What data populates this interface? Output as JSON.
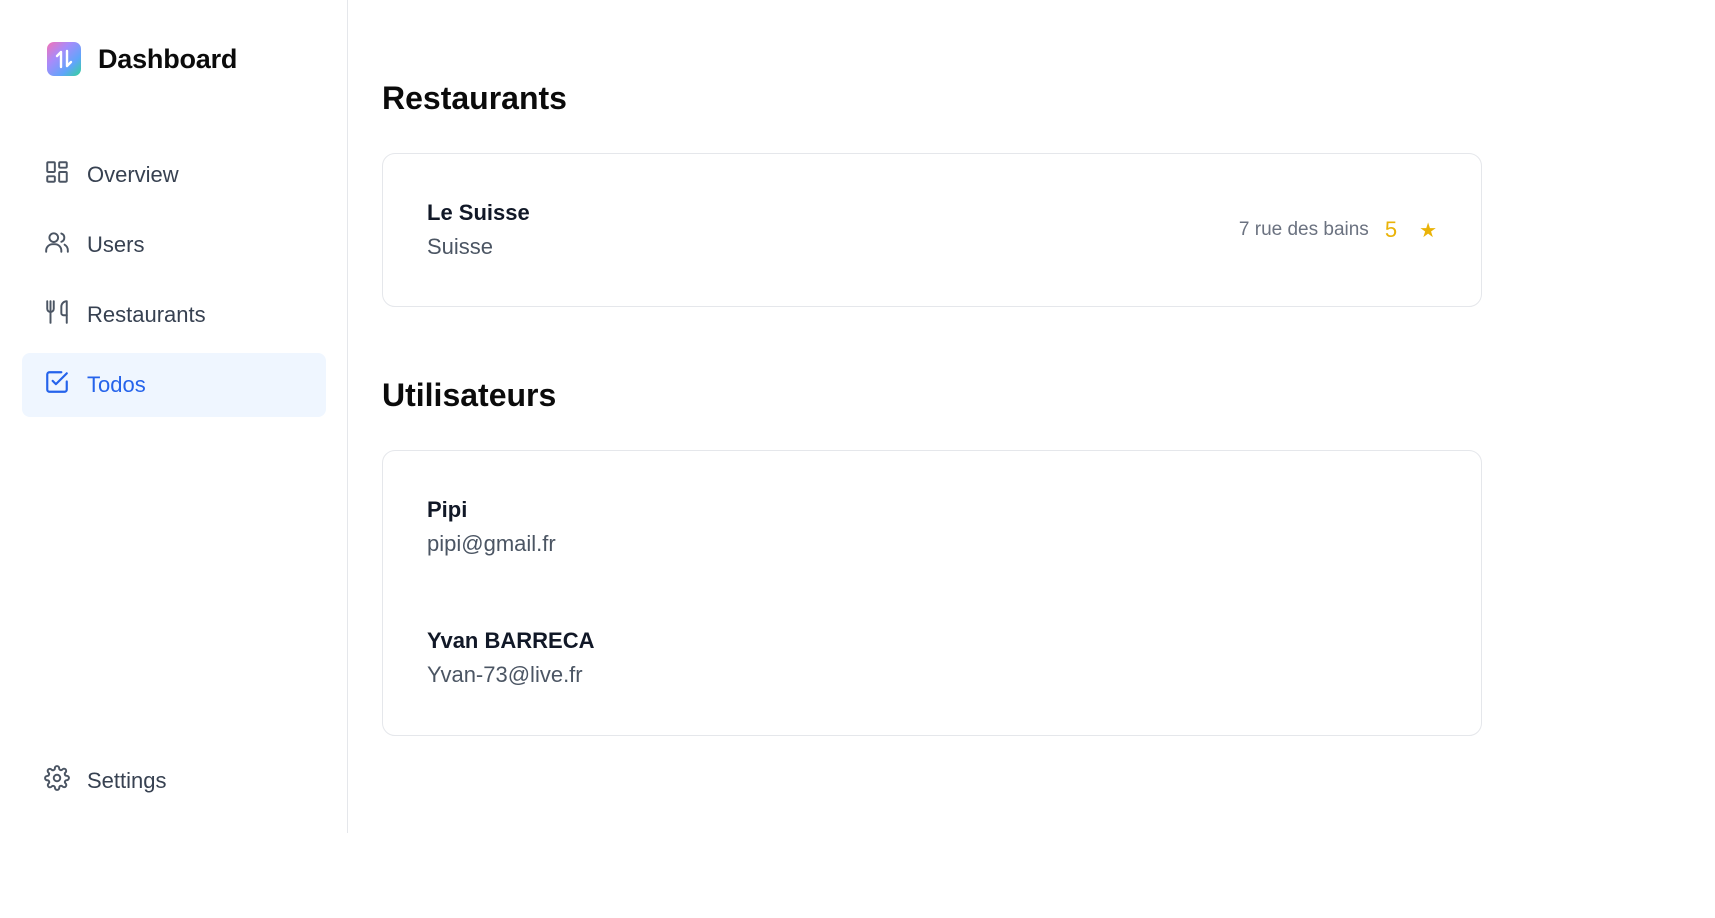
{
  "app": {
    "title": "Dashboard"
  },
  "sidebar": {
    "items": [
      {
        "label": "Overview",
        "icon": "overview-grid-icon",
        "active": false
      },
      {
        "label": "Users",
        "icon": "users-icon",
        "active": false
      },
      {
        "label": "Restaurants",
        "icon": "fork-knife-icon",
        "active": false
      },
      {
        "label": "Todos",
        "icon": "checkbox-icon",
        "active": true
      }
    ],
    "settings": {
      "label": "Settings",
      "icon": "gear-icon"
    }
  },
  "restaurants": {
    "title": "Restaurants",
    "items": [
      {
        "name": "Le Suisse",
        "cuisine": "Suisse",
        "address": "7 rue des bains",
        "rating": "5",
        "rating_icon": "star-icon"
      }
    ]
  },
  "users": {
    "title": "Utilisateurs",
    "items": [
      {
        "name": "Pipi",
        "email": "pipi@gmail.fr"
      },
      {
        "name": "Yvan BARRECA",
        "email": "Yvan-73@live.fr"
      }
    ]
  },
  "colors": {
    "accent": "#2563eb",
    "active_bg": "#eff6ff",
    "star": "#eab308",
    "border": "#e5e7eb"
  }
}
